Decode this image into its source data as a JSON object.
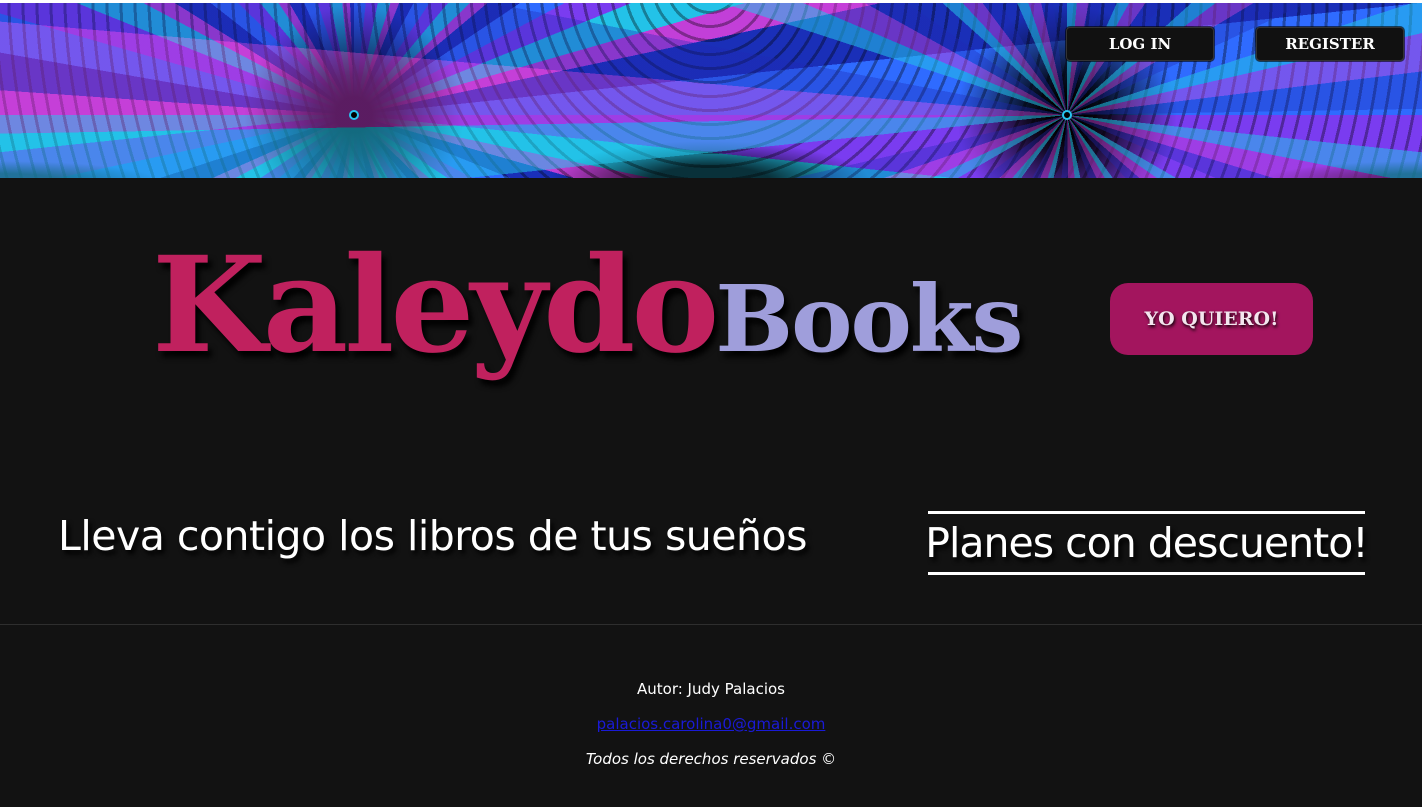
{
  "header": {
    "login_label": "LOG IN",
    "register_label": "REGISTER"
  },
  "hero": {
    "brand_part1": "Kaleydo",
    "brand_part2": "Books",
    "cta_label": "YO QUIERO!",
    "tagline": "Lleva contigo los libros de tus sueños",
    "plans_label": "Planes con descuento!"
  },
  "footer": {
    "author": "Autor: Judy Palacios",
    "email": "palacios.carolina0@gmail.com",
    "rights": "Todos los derechos reservados ©"
  },
  "colors": {
    "background": "#121212",
    "brand_primary": "#c0215e",
    "brand_secondary": "#9f9edb",
    "cta_background": "#a3155e",
    "link": "#1a1ad6"
  }
}
